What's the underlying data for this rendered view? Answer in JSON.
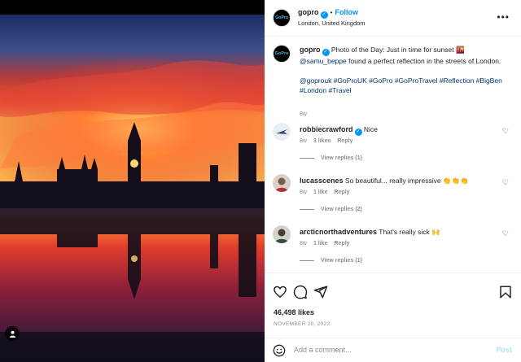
{
  "header": {
    "username": "gopro",
    "verified_mark": "✓",
    "separator": "•",
    "follow_label": "Follow",
    "location": "London, United Kingdom",
    "avatar_logo": "GoPro",
    "more_label": "•••"
  },
  "caption": {
    "username": "gopro",
    "text": "Photo of the Day: Just in time for sunset 🌇",
    "mention": "@samu_beppe",
    "text2": "found a perfect reflection in the streets of London.",
    "hashtags": "@goprouk #GoProUK #GoPro #GoProTravel #Reflection #BigBen #London #Travel",
    "age": "8w"
  },
  "comments": [
    {
      "username": "robbiecrawford",
      "verified": true,
      "text": "Nice",
      "age": "8w",
      "likes": "3 likes",
      "reply": "Reply",
      "view_replies": "View replies (1)"
    },
    {
      "username": "lucasscenes",
      "verified": false,
      "text": "So beautiful... really impressive 👏👏👏",
      "age": "8w",
      "likes": "1 like",
      "reply": "Reply",
      "view_replies": "View replies (2)"
    },
    {
      "username": "arcticnorthadventures",
      "verified": false,
      "text": "That's really sick 🙌",
      "age": "8w",
      "likes": "1 like",
      "reply": "Reply",
      "view_replies": "View replies (1)"
    }
  ],
  "actions": {
    "icons": [
      "heart-icon",
      "comment-icon",
      "share-icon",
      "bookmark-icon"
    ],
    "likes": "46,498 likes",
    "date": "NOVEMBER 20, 2022"
  },
  "add_comment": {
    "placeholder": "Add a comment...",
    "post_label": "Post"
  },
  "colors": {
    "accent": "#0095f6",
    "link": "#00376b",
    "muted": "#8e8e8e",
    "post_disabled": "#b2dffc"
  }
}
